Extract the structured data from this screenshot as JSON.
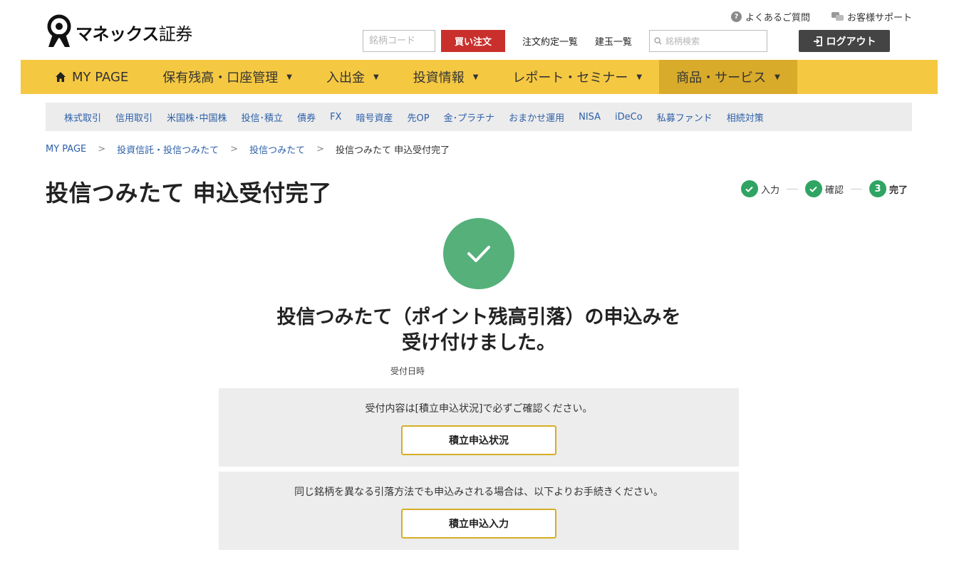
{
  "header": {
    "logo_text": "マネックス",
    "logo_text2": "証券",
    "faq_label": "よくあるご質問",
    "support_label": "お客様サポート",
    "code_placeholder": "銘柄コード",
    "buy_label": "買い注文",
    "orders_label": "注文約定一覧",
    "positions_label": "建玉一覧",
    "search_placeholder": "銘柄検索",
    "logout_label": "ログアウト"
  },
  "main_nav": [
    {
      "label": "MY PAGE"
    },
    {
      "label": "保有残高・口座管理"
    },
    {
      "label": "入出金"
    },
    {
      "label": "投資情報"
    },
    {
      "label": "レポート・セミナー"
    },
    {
      "label": "商品・サービス"
    }
  ],
  "sub_nav": [
    "株式取引",
    "信用取引",
    "米国株･中国株",
    "投信･積立",
    "債券",
    "FX",
    "暗号資産",
    "先OP",
    "金･プラチナ",
    "おまかせ運用",
    "NISA",
    "iDeCo",
    "私募ファンド",
    "相続対策"
  ],
  "breadcrumb": {
    "items": [
      "MY PAGE",
      "投資信託・投信つみたて",
      "投信つみたて"
    ],
    "separator": ">",
    "current": "投信つみたて 申込受付完了"
  },
  "page_title": "投信つみたて 申込受付完了",
  "steps": [
    {
      "label": "入力",
      "status": "done"
    },
    {
      "label": "確認",
      "status": "done"
    },
    {
      "label": "完了",
      "number": "3",
      "status": "current"
    }
  ],
  "success": {
    "line1": "投信つみたて（ポイント残高引落）の申込みを",
    "line2": "受け付けました。",
    "received_label": "受付日時"
  },
  "box1": {
    "text": "受付内容は[積立申込状況]で必ずご確認ください。",
    "button": "積立申込状況"
  },
  "box2": {
    "text": "同じ銘柄を異なる引落方法でも申込みされる場合は、以下よりお手続きください。",
    "button": "積立申込入力"
  },
  "colors": {
    "nav_bg": "#f5c842",
    "nav_active": "#d9ab2b",
    "buy_red": "#c9302c",
    "success_green": "#55b07a",
    "step_green": "#2fa463",
    "link_blue": "#2d5fa8",
    "button_border": "#d6ae26"
  }
}
